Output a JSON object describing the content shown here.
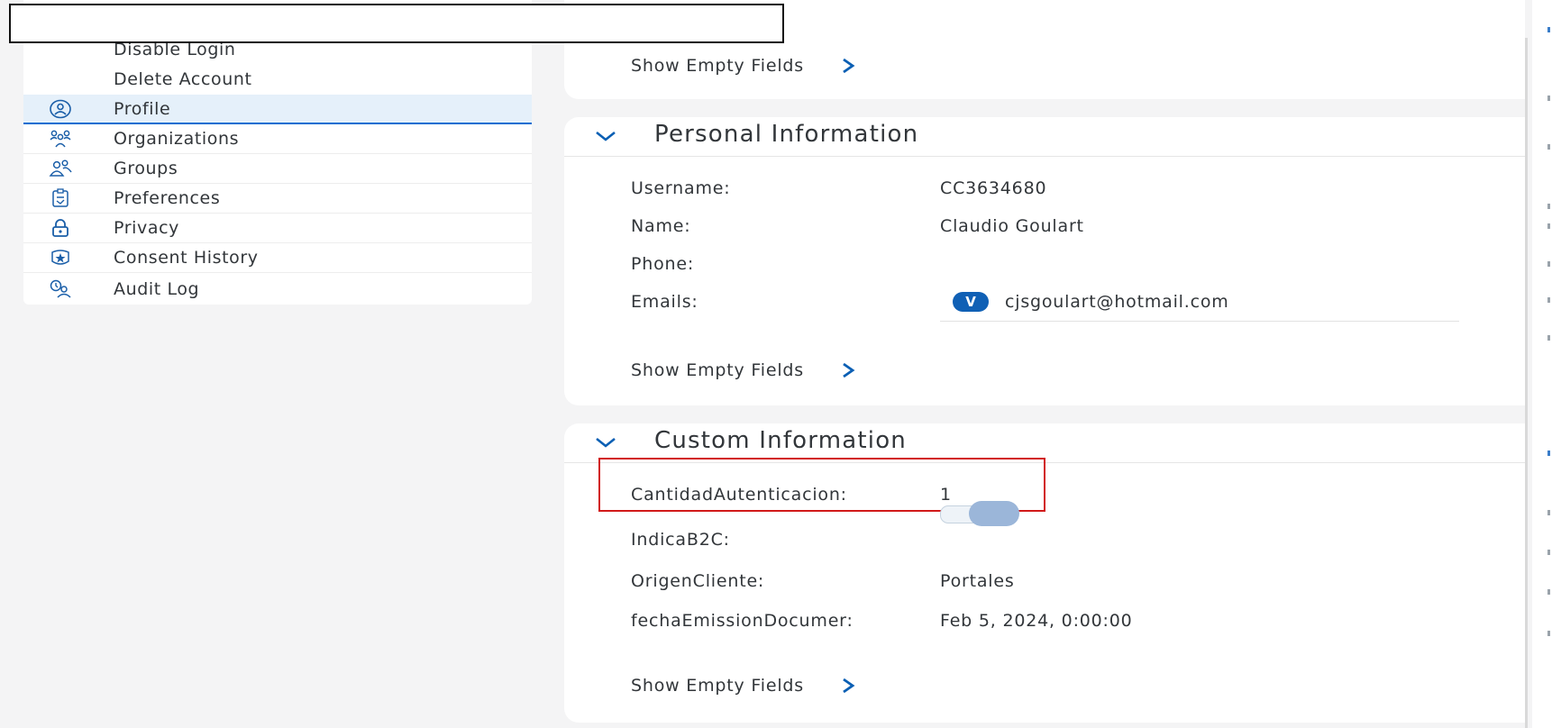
{
  "sidebar": {
    "items": [
      {
        "label": "Disable Login",
        "icon": ""
      },
      {
        "label": "Delete Account",
        "icon": ""
      },
      {
        "label": "Profile",
        "icon": "profile-icon"
      },
      {
        "label": "Organizations",
        "icon": "organizations-icon"
      },
      {
        "label": "Groups",
        "icon": "groups-icon"
      },
      {
        "label": "Preferences",
        "icon": "preferences-icon"
      },
      {
        "label": "Privacy",
        "icon": "lock-icon"
      },
      {
        "label": "Consent History",
        "icon": "consent-history-icon"
      },
      {
        "label": "Audit Log",
        "icon": "audit-log-icon"
      }
    ],
    "active": "Profile"
  },
  "top_card": {
    "show_empty": "Show Empty Fields"
  },
  "personal": {
    "title": "Personal Information",
    "username_label": "Username:",
    "username_value": "CC3634680",
    "name_label": "Name:",
    "name_value": "Claudio Goulart",
    "phone_label": "Phone:",
    "emails_label": "Emails:",
    "email_badge": "V",
    "email_value": "cjsgoulart@hotmail.com",
    "show_empty": "Show Empty Fields"
  },
  "custom": {
    "title": "Custom Information",
    "cantidad_label": "CantidadAutenticacion:",
    "cantidad_value": "1",
    "indica_label": "IndicaB2C:",
    "indica_on": true,
    "origen_label": "OrigenCliente:",
    "origen_value": "Portales",
    "fecha_label": "fechaEmissionDocumer:",
    "fecha_value": "Feb 5, 2024, 0:00:00",
    "show_empty": "Show Empty Fields"
  },
  "colors": {
    "accent": "#0a6ed1",
    "highlight_box": "#d11a1a",
    "active_bg": "#e5f0fa"
  }
}
